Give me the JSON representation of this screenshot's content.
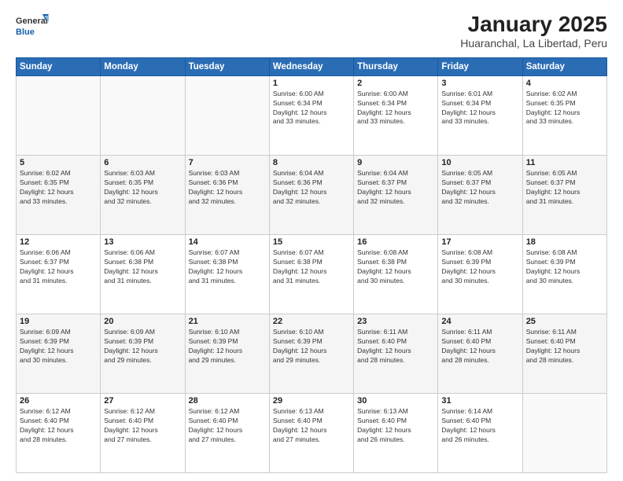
{
  "header": {
    "logo": {
      "general": "General",
      "blue": "Blue"
    },
    "title": "January 2025",
    "subtitle": "Huaranchal, La Libertad, Peru"
  },
  "weekdays": [
    "Sunday",
    "Monday",
    "Tuesday",
    "Wednesday",
    "Thursday",
    "Friday",
    "Saturday"
  ],
  "weeks": [
    [
      {
        "day": "",
        "info": ""
      },
      {
        "day": "",
        "info": ""
      },
      {
        "day": "",
        "info": ""
      },
      {
        "day": "1",
        "info": "Sunrise: 6:00 AM\nSunset: 6:34 PM\nDaylight: 12 hours\nand 33 minutes."
      },
      {
        "day": "2",
        "info": "Sunrise: 6:00 AM\nSunset: 6:34 PM\nDaylight: 12 hours\nand 33 minutes."
      },
      {
        "day": "3",
        "info": "Sunrise: 6:01 AM\nSunset: 6:34 PM\nDaylight: 12 hours\nand 33 minutes."
      },
      {
        "day": "4",
        "info": "Sunrise: 6:02 AM\nSunset: 6:35 PM\nDaylight: 12 hours\nand 33 minutes."
      }
    ],
    [
      {
        "day": "5",
        "info": "Sunrise: 6:02 AM\nSunset: 6:35 PM\nDaylight: 12 hours\nand 33 minutes."
      },
      {
        "day": "6",
        "info": "Sunrise: 6:03 AM\nSunset: 6:35 PM\nDaylight: 12 hours\nand 32 minutes."
      },
      {
        "day": "7",
        "info": "Sunrise: 6:03 AM\nSunset: 6:36 PM\nDaylight: 12 hours\nand 32 minutes."
      },
      {
        "day": "8",
        "info": "Sunrise: 6:04 AM\nSunset: 6:36 PM\nDaylight: 12 hours\nand 32 minutes."
      },
      {
        "day": "9",
        "info": "Sunrise: 6:04 AM\nSunset: 6:37 PM\nDaylight: 12 hours\nand 32 minutes."
      },
      {
        "day": "10",
        "info": "Sunrise: 6:05 AM\nSunset: 6:37 PM\nDaylight: 12 hours\nand 32 minutes."
      },
      {
        "day": "11",
        "info": "Sunrise: 6:05 AM\nSunset: 6:37 PM\nDaylight: 12 hours\nand 31 minutes."
      }
    ],
    [
      {
        "day": "12",
        "info": "Sunrise: 6:06 AM\nSunset: 6:37 PM\nDaylight: 12 hours\nand 31 minutes."
      },
      {
        "day": "13",
        "info": "Sunrise: 6:06 AM\nSunset: 6:38 PM\nDaylight: 12 hours\nand 31 minutes."
      },
      {
        "day": "14",
        "info": "Sunrise: 6:07 AM\nSunset: 6:38 PM\nDaylight: 12 hours\nand 31 minutes."
      },
      {
        "day": "15",
        "info": "Sunrise: 6:07 AM\nSunset: 6:38 PM\nDaylight: 12 hours\nand 31 minutes."
      },
      {
        "day": "16",
        "info": "Sunrise: 6:08 AM\nSunset: 6:38 PM\nDaylight: 12 hours\nand 30 minutes."
      },
      {
        "day": "17",
        "info": "Sunrise: 6:08 AM\nSunset: 6:39 PM\nDaylight: 12 hours\nand 30 minutes."
      },
      {
        "day": "18",
        "info": "Sunrise: 6:08 AM\nSunset: 6:39 PM\nDaylight: 12 hours\nand 30 minutes."
      }
    ],
    [
      {
        "day": "19",
        "info": "Sunrise: 6:09 AM\nSunset: 6:39 PM\nDaylight: 12 hours\nand 30 minutes."
      },
      {
        "day": "20",
        "info": "Sunrise: 6:09 AM\nSunset: 6:39 PM\nDaylight: 12 hours\nand 29 minutes."
      },
      {
        "day": "21",
        "info": "Sunrise: 6:10 AM\nSunset: 6:39 PM\nDaylight: 12 hours\nand 29 minutes."
      },
      {
        "day": "22",
        "info": "Sunrise: 6:10 AM\nSunset: 6:39 PM\nDaylight: 12 hours\nand 29 minutes."
      },
      {
        "day": "23",
        "info": "Sunrise: 6:11 AM\nSunset: 6:40 PM\nDaylight: 12 hours\nand 28 minutes."
      },
      {
        "day": "24",
        "info": "Sunrise: 6:11 AM\nSunset: 6:40 PM\nDaylight: 12 hours\nand 28 minutes."
      },
      {
        "day": "25",
        "info": "Sunrise: 6:11 AM\nSunset: 6:40 PM\nDaylight: 12 hours\nand 28 minutes."
      }
    ],
    [
      {
        "day": "26",
        "info": "Sunrise: 6:12 AM\nSunset: 6:40 PM\nDaylight: 12 hours\nand 28 minutes."
      },
      {
        "day": "27",
        "info": "Sunrise: 6:12 AM\nSunset: 6:40 PM\nDaylight: 12 hours\nand 27 minutes."
      },
      {
        "day": "28",
        "info": "Sunrise: 6:12 AM\nSunset: 6:40 PM\nDaylight: 12 hours\nand 27 minutes."
      },
      {
        "day": "29",
        "info": "Sunrise: 6:13 AM\nSunset: 6:40 PM\nDaylight: 12 hours\nand 27 minutes."
      },
      {
        "day": "30",
        "info": "Sunrise: 6:13 AM\nSunset: 6:40 PM\nDaylight: 12 hours\nand 26 minutes."
      },
      {
        "day": "31",
        "info": "Sunrise: 6:14 AM\nSunset: 6:40 PM\nDaylight: 12 hours\nand 26 minutes."
      },
      {
        "day": "",
        "info": ""
      }
    ]
  ]
}
